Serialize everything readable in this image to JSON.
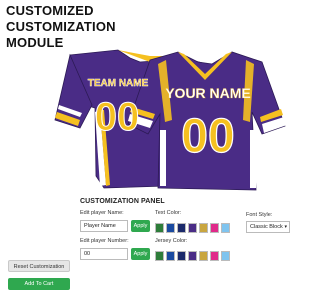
{
  "header": {
    "line1": "CUSTOMIZED",
    "line2": "CUSTOMIZATION",
    "line3": "MODULE"
  },
  "jersey_back": {
    "name": "TEAM NAME",
    "number": "00"
  },
  "jersey_front": {
    "name": "YOUR NAME",
    "number": "00"
  },
  "colors": {
    "purple": "#4a2c86",
    "gold": "#f5c020",
    "white": "#ffffff"
  },
  "panel": {
    "title": "CUSTOMIZATION PANEL",
    "player_name_label": "Edit player Name:",
    "player_name_value": "Player Name",
    "player_number_label": "Edit player Number:",
    "player_number_value": "00",
    "apply_label": "Apply",
    "text_color_label": "Text Color:",
    "jersey_color_label": "Jersey Color:",
    "font_style_label": "Font Style:",
    "font_style_value": "Classic Block",
    "swatches": [
      "#2e7d3a",
      "#1a4aa0",
      "#1b2a6b",
      "#4a2c86",
      "#c9a640",
      "#e02a8a",
      "#7fc4ef"
    ]
  },
  "buttons": {
    "reset_label": "Reset Customization",
    "add_to_cart_label": "Add To Cart"
  }
}
